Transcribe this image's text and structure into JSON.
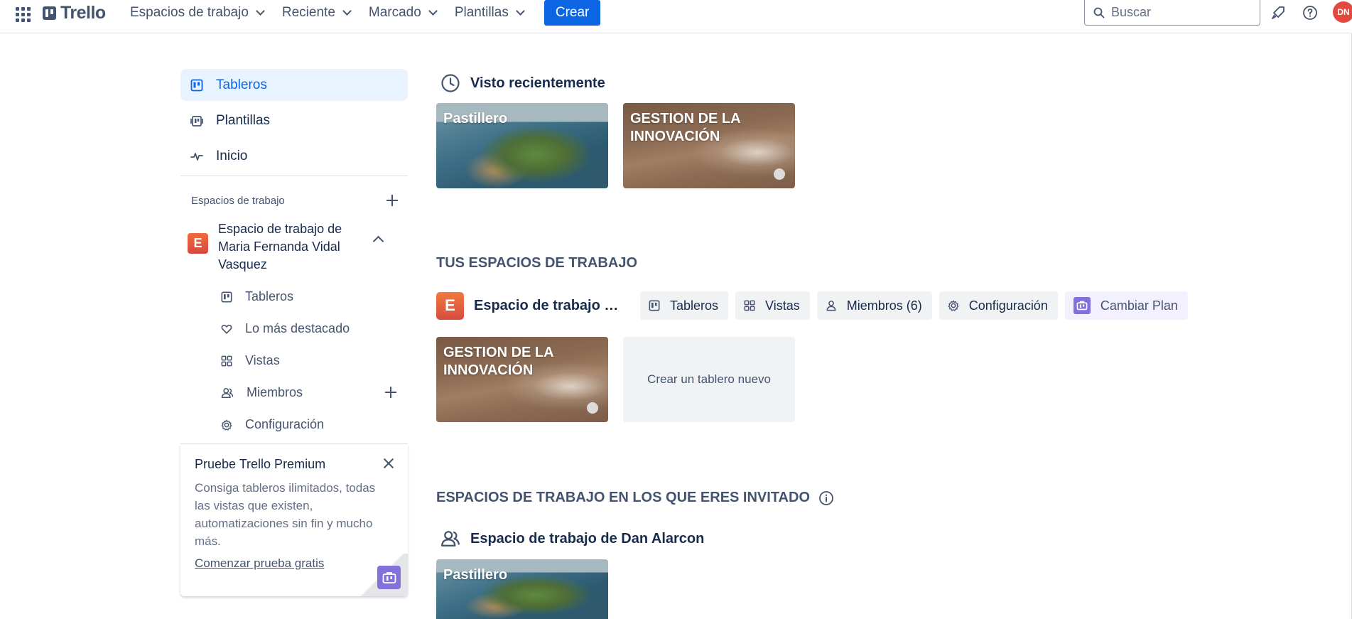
{
  "topbar": {
    "logo_text": "Trello",
    "menus": [
      {
        "label": "Espacios de trabajo"
      },
      {
        "label": "Reciente"
      },
      {
        "label": "Marcado"
      },
      {
        "label": "Plantillas"
      }
    ],
    "create_label": "Crear",
    "search_placeholder": "Buscar",
    "avatar_initials": "DN",
    "icons": [
      "apps-grid-icon",
      "trello-logo-icon",
      "search-icon",
      "notifications-rocket-icon",
      "help-icon"
    ]
  },
  "sidebar": {
    "items": [
      {
        "label": "Tableros",
        "icon": "boards-icon",
        "active": true
      },
      {
        "label": "Plantillas",
        "icon": "templates-icon",
        "active": false
      },
      {
        "label": "Inicio",
        "icon": "activity-icon",
        "active": false
      }
    ],
    "workspaces_header": "Espacios de trabajo",
    "workspace": {
      "badge": "E",
      "name": "Espacio de trabajo de Maria Fernanda Vidal Vasquez",
      "subitems": [
        {
          "label": "Tableros",
          "icon": "boards-icon"
        },
        {
          "label": "Lo más destacado",
          "icon": "heart-icon"
        },
        {
          "label": "Vistas",
          "icon": "views-grid-icon"
        },
        {
          "label": "Miembros",
          "icon": "members-icon"
        },
        {
          "label": "Configuración",
          "icon": "gear-icon"
        }
      ]
    },
    "promo": {
      "title": "Pruebe Trello Premium",
      "text": "Consiga tableros ilimitados, todas las vistas que existen, automatizaciones sin fin y mucho más.",
      "link": "Comenzar prueba gratis"
    }
  },
  "main": {
    "recent": {
      "title": "Visto recientemente",
      "boards": [
        {
          "title": "Pastillero"
        },
        {
          "title": "GESTION DE LA INNOVACIÓN"
        }
      ]
    },
    "your_workspaces": {
      "title": "TUS ESPACIOS DE TRABAJO",
      "workspace_badge": "E",
      "workspace_name": "Espacio de trabajo d...",
      "chips": [
        {
          "label": "Tableros",
          "icon": "boards-icon"
        },
        {
          "label": "Vistas",
          "icon": "views-grid-icon"
        },
        {
          "label": "Miembros (6)",
          "icon": "member-icon"
        },
        {
          "label": "Configuración",
          "icon": "gear-icon"
        },
        {
          "label": "Cambiar Plan",
          "icon": "upgrade-icon"
        }
      ],
      "boards": [
        {
          "title": "GESTION DE LA INNOVACIÓN"
        }
      ],
      "create_board_label": "Crear un tablero nuevo"
    },
    "guest_workspaces": {
      "title": "ESPACIOS DE TRABAJO EN LOS QUE ERES INVITADO",
      "workspace_name": "Espacio de trabajo de Dan Alarcon",
      "boards": [
        {
          "title": "Pastillero"
        }
      ]
    }
  },
  "colors": {
    "accent": "#0c66e4",
    "active_bg": "#e9f2ff",
    "text": "#172b4d",
    "subtle_text": "#44546f",
    "avatar": "#e2483d",
    "upgrade": "#8270db"
  }
}
